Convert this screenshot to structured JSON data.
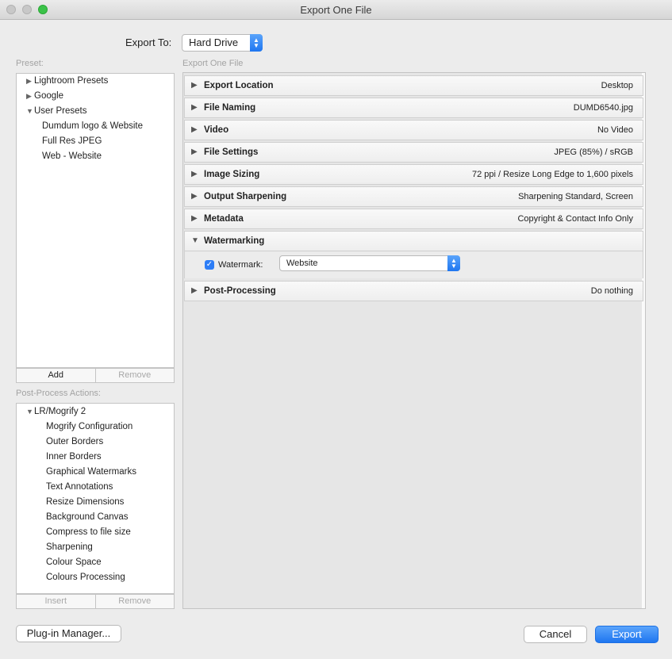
{
  "window": {
    "title": "Export One File"
  },
  "export_to": {
    "label": "Export To:",
    "value": "Hard Drive"
  },
  "preset": {
    "label": "Preset:",
    "tree": [
      {
        "label": "Lightroom Presets",
        "expanded": false,
        "indent": 0
      },
      {
        "label": "Google",
        "expanded": false,
        "indent": 0
      },
      {
        "label": "User Presets",
        "expanded": true,
        "indent": 0
      },
      {
        "label": "Dumdum logo & Website",
        "indent": 1
      },
      {
        "label": "Full Res JPEG",
        "indent": 1
      },
      {
        "label": "Web - Website",
        "indent": 1
      }
    ],
    "add_label": "Add",
    "remove_label": "Remove"
  },
  "post_process": {
    "label": "Post-Process Actions:",
    "group": "LR/Mogrify 2",
    "items": [
      "Mogrify Configuration",
      "Outer Borders",
      "Inner Borders",
      "Graphical Watermarks",
      "Text Annotations",
      "Resize Dimensions",
      "Background Canvas",
      "Compress to file size",
      "Sharpening",
      "Colour Space",
      "Colours Processing"
    ],
    "insert_label": "Insert",
    "remove_label": "Remove"
  },
  "main": {
    "heading": "Export One File",
    "sections": [
      {
        "name": "Export Location",
        "value": "Desktop",
        "expanded": false
      },
      {
        "name": "File Naming",
        "value": "DUMD6540.jpg",
        "expanded": false
      },
      {
        "name": "Video",
        "value": "No Video",
        "expanded": false
      },
      {
        "name": "File Settings",
        "value": "JPEG (85%) / sRGB",
        "expanded": false
      },
      {
        "name": "Image Sizing",
        "value": "72 ppi / Resize Long Edge to 1,600 pixels",
        "expanded": false
      },
      {
        "name": "Output Sharpening",
        "value": "Sharpening Standard, Screen",
        "expanded": false
      },
      {
        "name": "Metadata",
        "value": "Copyright & Contact Info Only",
        "expanded": false
      },
      {
        "name": "Watermarking",
        "value": "",
        "expanded": true
      },
      {
        "name": "Post-Processing",
        "value": "Do nothing",
        "expanded": false
      }
    ],
    "watermark": {
      "label": "Watermark:",
      "checked": true,
      "value": "Website"
    }
  },
  "buttons": {
    "plugin_manager": "Plug-in Manager...",
    "cancel": "Cancel",
    "export": "Export"
  },
  "icons": {
    "collapsed": "triangle-right-icon",
    "expanded": "triangle-down-icon",
    "check": "checkmark-icon",
    "stepper": "up-down-arrows-icon"
  },
  "colors": {
    "accent": "#1f76f0",
    "maximize": "#3bc249"
  }
}
